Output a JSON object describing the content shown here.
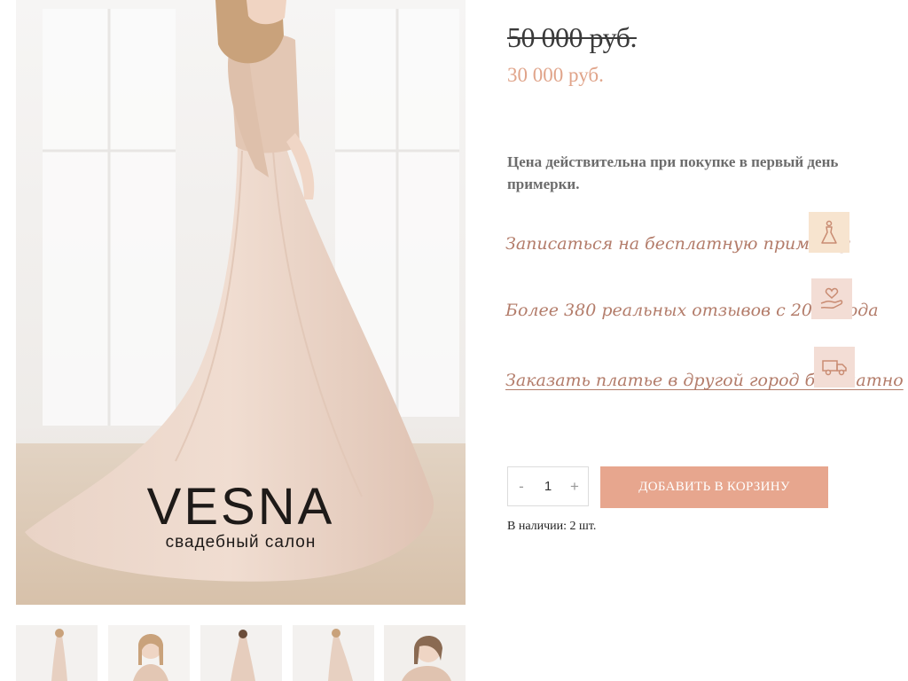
{
  "brand": {
    "name": "VESNA",
    "tagline": "свадебный салон"
  },
  "product": {
    "old_price": "50 000 руб.",
    "new_price": "30 000 руб.",
    "price_note": "Цена действительна при покупке в первый день примерки."
  },
  "features": [
    {
      "label": "Записаться на бесплатную примерку",
      "icon": "dress-icon",
      "bg": "#f7e4cf"
    },
    {
      "label": "Более 380 реальных отзывов с 2012 года",
      "icon": "heart-hand-icon",
      "bg": "#f3ddd5"
    },
    {
      "label": "Заказать платье в другой город бесплатно",
      "icon": "truck-icon",
      "bg": "#f3ddd5"
    }
  ],
  "cart": {
    "minus": "-",
    "quantity": "1",
    "plus": "+",
    "add_label": "ДОБАВИТЬ В КОРЗИНУ",
    "stock": "В наличии: 2 шт."
  },
  "thumbnails": [
    "front view",
    "close-up view",
    "back view",
    "side view",
    "detail view"
  ],
  "colors": {
    "accent": "#e7a68e",
    "price": "#e0a48a",
    "feature_text": "#b37c6a"
  }
}
